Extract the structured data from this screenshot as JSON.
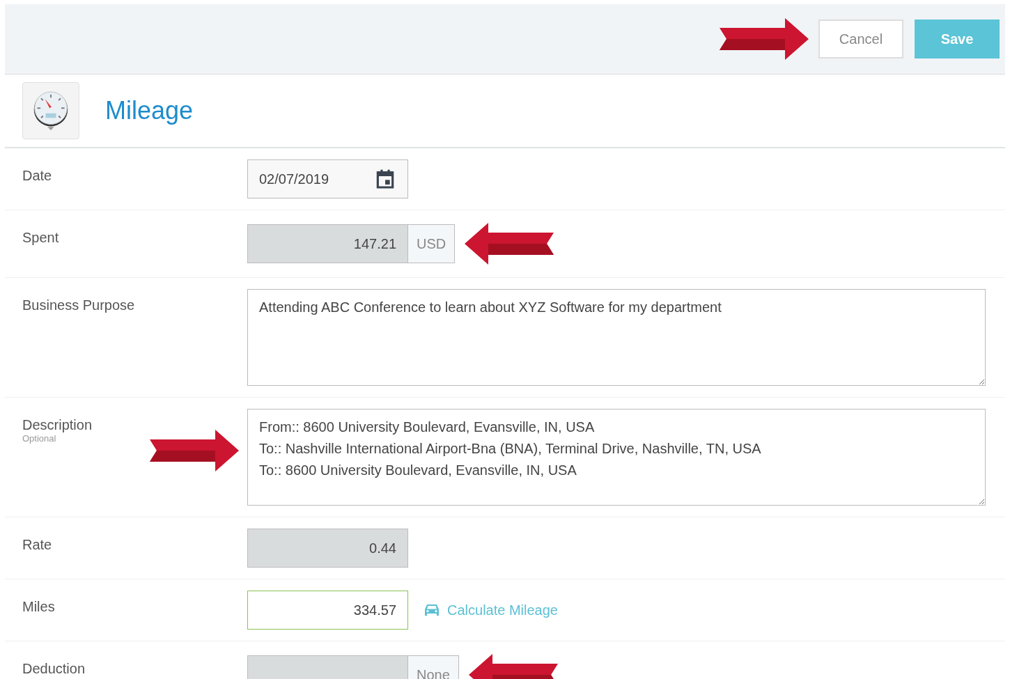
{
  "header": {
    "arrow_right": true,
    "buttons": [
      {
        "label": "Cancel",
        "kind": "secondary"
      },
      {
        "label": "Save",
        "kind": "primary"
      }
    ]
  },
  "title": "Mileage",
  "rows": [
    {
      "label": "Date",
      "kind": "date",
      "value": "02/07/2019"
    },
    {
      "label": "Spent",
      "kind": "addon",
      "value": "147.21",
      "addon": "USD",
      "arrow_left": true
    },
    {
      "label": "Business Purpose",
      "kind": "textarea",
      "value": "Attending ABC Conference to learn about XYZ Software for my department"
    },
    {
      "label": "Description",
      "hint": "Optional",
      "kind": "textarea",
      "value": "From:: 8600 University Boulevard, Evansville, IN, USA\nTo:: Nashville International Airport-Bna (BNA), Terminal Drive, Nashville, TN, USA\nTo:: 8600 University Boulevard, Evansville, IN, USA",
      "arrow_right": true
    },
    {
      "label": "Rate",
      "kind": "readonly",
      "value": "0.44"
    },
    {
      "label": "Miles",
      "kind": "miles",
      "value": "334.57",
      "link": "Calculate Mileage"
    },
    {
      "label": "Deduction",
      "kind": "addon",
      "value": "",
      "addon": "None",
      "arrow_left": true
    }
  ]
}
